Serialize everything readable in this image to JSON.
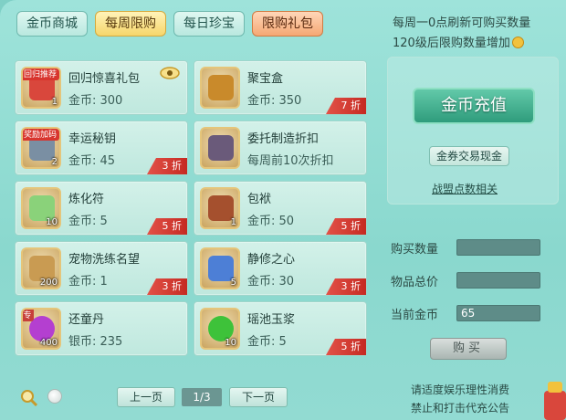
{
  "tabs": [
    {
      "label": "金币商城",
      "state": "normal"
    },
    {
      "label": "每周限购",
      "state": "active"
    },
    {
      "label": "每日珍宝",
      "state": "normal"
    },
    {
      "label": "限购礼包",
      "state": "hot"
    }
  ],
  "items": [
    {
      "name": "回归惊喜礼包",
      "price": "金币: 300",
      "tag": "回归推荐",
      "count": "1",
      "discount": "",
      "icon": "gift-box-icon",
      "color": "#d9473c"
    },
    {
      "name": "聚宝盒",
      "price": "金币: 350",
      "tag": "",
      "count": "",
      "discount": "7 折",
      "icon": "treasure-box-icon",
      "color": "#c98a2b"
    },
    {
      "name": "幸运秘钥",
      "price": "金币: 45",
      "tag": "奖励加码",
      "count": "2",
      "discount": "3 折",
      "icon": "key-icon",
      "color": "#7a8fa3"
    },
    {
      "name": "委托制造折扣",
      "price": "每周前10次折扣",
      "tag": "",
      "count": "",
      "discount": "",
      "icon": "hammer-icon",
      "color": "#6a5a7a"
    },
    {
      "name": "炼化符",
      "price": "金币: 5",
      "tag": "",
      "count": "10",
      "discount": "5 折",
      "icon": "talisman-icon",
      "color": "#8ad27a"
    },
    {
      "name": "包袱",
      "price": "金币: 50",
      "tag": "",
      "count": "1",
      "discount": "5 折",
      "icon": "bag-icon",
      "color": "#a5502e"
    },
    {
      "name": "宠物洗练名望",
      "price": "金币: 1",
      "tag": "",
      "count": "200",
      "discount": "3 折",
      "icon": "paw-icon",
      "color": "#c99b52"
    },
    {
      "name": "静修之心",
      "price": "金币: 30",
      "tag": "",
      "count": "5",
      "discount": "3 折",
      "icon": "heart-gem-icon",
      "color": "#4d7fd6"
    },
    {
      "name": "还童丹",
      "price": "银币: 235",
      "tag": "专",
      "count": "400",
      "discount": "",
      "icon": "pill-icon",
      "color": "#b43fd0"
    },
    {
      "name": "瑶池玉浆",
      "price": "金币: 5",
      "tag": "",
      "count": "10",
      "discount": "5 折",
      "icon": "potion-icon",
      "color": "#3ec23a"
    }
  ],
  "panel": {
    "notice_line1": "每周一0点刷新可购买数量",
    "notice_line2": "120级后限购数量增加",
    "recharge_label": "金币充值",
    "exchange_label": "金券交易现金",
    "alliance_label": "战盟点数相关",
    "buy_qty_label": "购买数量",
    "buy_qty_value": "",
    "total_label": "物品总价",
    "total_value": "",
    "current_gold_label": "当前金币",
    "current_gold_value": "65",
    "buy_label": "购买"
  },
  "pager": {
    "prev_label": "上一页",
    "page_info": "1/3",
    "next_label": "下一页"
  },
  "footer": {
    "warning_line1": "请适度娱乐理性消费",
    "warning_line2": "禁止和打击代充公告"
  },
  "colors": {
    "background": "#8ad8ce",
    "discount_red": "#c52a22",
    "recharge_green": "#2f9c7c"
  }
}
